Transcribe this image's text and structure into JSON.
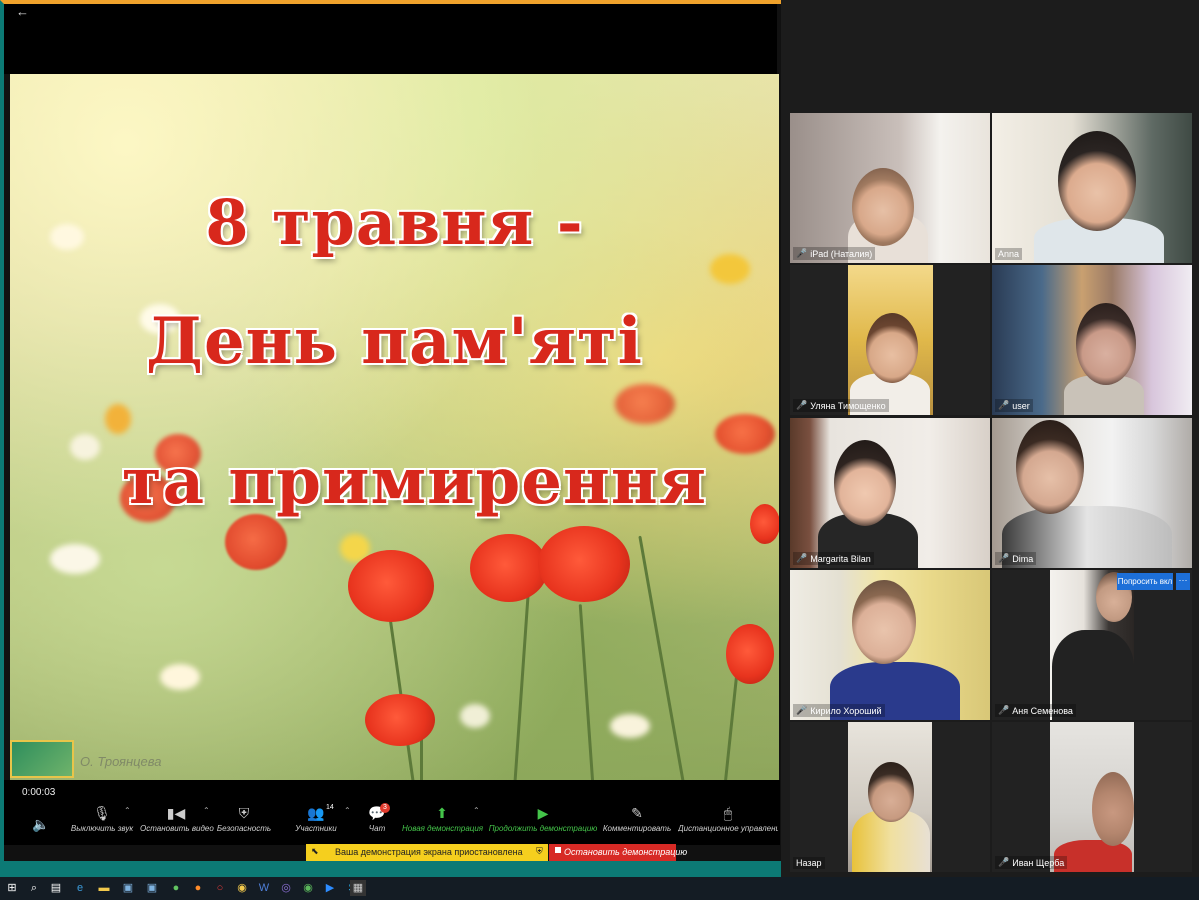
{
  "presentation": {
    "slide_lines": [
      "8 травня -",
      "День пам'яті",
      "та примирення"
    ],
    "watermark_text": "О. Троянцева"
  },
  "player": {
    "elapsed": "0:00:03"
  },
  "toolbar": {
    "mute": "Выключить звук",
    "stop_video": "Остановить видео",
    "security": "Безопасность",
    "participants": "Участники",
    "participants_count": "14",
    "chat": "Чат",
    "chat_badge": "3",
    "new_share": "Новая демонстрация",
    "resume_share": "Продолжить демонстрацию",
    "annotate": "Комментировать",
    "remote_control": "Дистанционное управление"
  },
  "share_status": {
    "paused_text": "Ваша демонстрация экрана приостановлена",
    "stop_label": "Остановить демонстрацию"
  },
  "gallery": {
    "participants": [
      "iPad (Наталия)",
      "Anna",
      "Уляна Тимощенко",
      "user",
      "Margarita Bilan",
      "Dima",
      "Кирило Хороший",
      "Аня Семенова",
      "Назар",
      "Иван Щерба"
    ],
    "ask_button": "Попросить вкл",
    "more_button": "···"
  },
  "colors": {
    "accent_orange": "#f0a22b",
    "share_teal": "#0c7a75",
    "pause_yellow": "#f5cf1e",
    "stop_red": "#d72a25",
    "slide_title_red": "#d8281c",
    "active_speaker": "#d2d84a",
    "action_blue": "#1d6fd8"
  },
  "icons": {
    "back": "arrow-left-icon",
    "volume": "speaker-icon",
    "mic": "microphone-icon",
    "camera": "camera-icon",
    "shield": "shield-icon",
    "people": "people-icon",
    "chat": "chat-bubble-icon",
    "share": "share-screen-icon",
    "play": "play-icon",
    "pencil": "pencil-icon",
    "mouse": "mouse-icon",
    "muted_mic": "mic-muted-icon"
  }
}
